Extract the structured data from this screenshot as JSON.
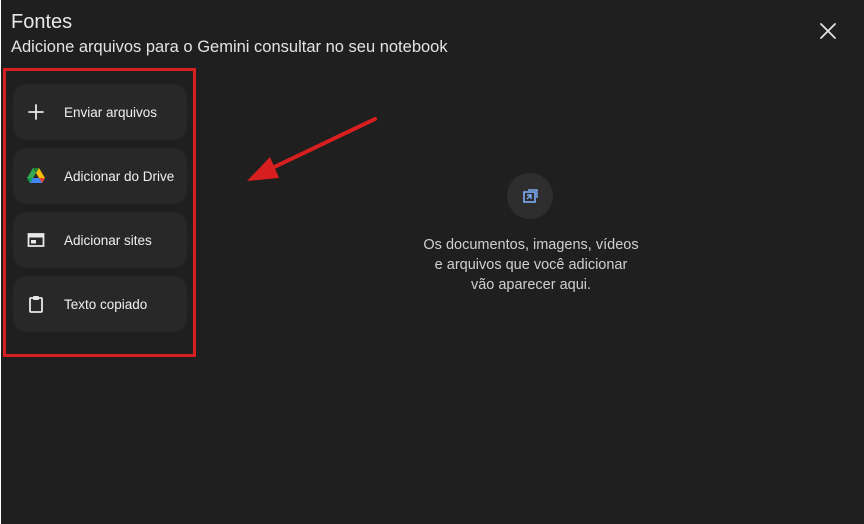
{
  "dialog": {
    "title": "Fontes",
    "subtitle": "Adicione arquivos para o Gemini consultar no seu notebook",
    "close_icon": "close-icon"
  },
  "options": [
    {
      "label": "Enviar arquivos",
      "icon": "plus-icon"
    },
    {
      "label": "Adicionar do Drive",
      "icon": "google-drive-icon"
    },
    {
      "label": "Adicionar sites",
      "icon": "website-icon"
    },
    {
      "label": "Texto copiado",
      "icon": "clipboard-icon"
    }
  ],
  "empty_state": {
    "icon": "add-source-icon",
    "lines": [
      "Os documentos, imagens, vídeos",
      "e arquivos que você adicionar",
      "vão aparecer aqui."
    ]
  },
  "colors": {
    "background": "#1f1f1f",
    "option_background": "#282828",
    "annotation_red": "#d71f1f",
    "accent_blue": "#7cacf8"
  }
}
